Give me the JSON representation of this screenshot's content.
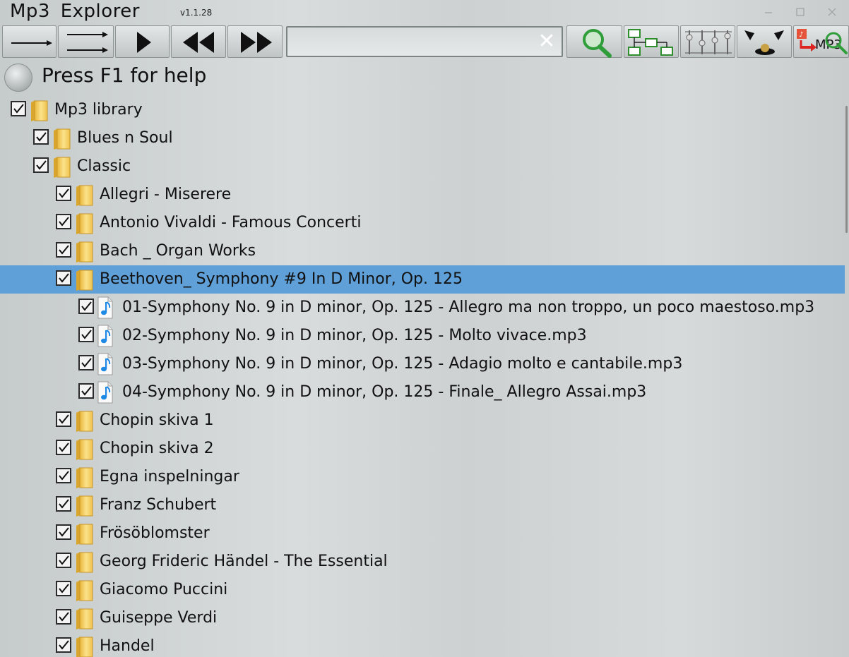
{
  "window": {
    "title": "Mp3  Explorer",
    "version": "v1.1.28"
  },
  "toolbar": {
    "search_value": "",
    "clear_glyph": "✕"
  },
  "status": {
    "text": "Press F1 for help"
  },
  "tree": {
    "rows": [
      {
        "label": "Mp3 library",
        "type": "folder",
        "level": 0,
        "checked": true,
        "selected": false
      },
      {
        "label": "Blues n Soul",
        "type": "folder",
        "level": 1,
        "checked": true,
        "selected": false
      },
      {
        "label": "Classic",
        "type": "folder",
        "level": 1,
        "checked": true,
        "selected": false
      },
      {
        "label": "Allegri - Miserere",
        "type": "folder",
        "level": 2,
        "checked": true,
        "selected": false
      },
      {
        "label": "Antonio Vivaldi - Famous Concerti",
        "type": "folder",
        "level": 2,
        "checked": true,
        "selected": false
      },
      {
        "label": "Bach _ Organ Works",
        "type": "folder",
        "level": 2,
        "checked": true,
        "selected": false
      },
      {
        "label": "Beethoven_ Symphony #9 In D Minor, Op. 125",
        "type": "folder",
        "level": 2,
        "checked": true,
        "selected": true
      },
      {
        "label": "01-Symphony No. 9 in D minor, Op. 125 - Allegro ma non troppo, un poco maestoso.mp3",
        "type": "file",
        "level": 3,
        "checked": true,
        "selected": false
      },
      {
        "label": "02-Symphony No. 9 in D minor, Op. 125 - Molto vivace.mp3",
        "type": "file",
        "level": 3,
        "checked": true,
        "selected": false
      },
      {
        "label": "03-Symphony No. 9 in D minor, Op. 125 - Adagio molto e cantabile.mp3",
        "type": "file",
        "level": 3,
        "checked": true,
        "selected": false
      },
      {
        "label": "04-Symphony No. 9 in D minor, Op. 125 - Finale_ Allegro Assai.mp3",
        "type": "file",
        "level": 3,
        "checked": true,
        "selected": false
      },
      {
        "label": "Chopin skiva 1",
        "type": "folder",
        "level": 2,
        "checked": true,
        "selected": false
      },
      {
        "label": "Chopin skiva 2",
        "type": "folder",
        "level": 2,
        "checked": true,
        "selected": false
      },
      {
        "label": "Egna inspelningar",
        "type": "folder",
        "level": 2,
        "checked": true,
        "selected": false
      },
      {
        "label": "Franz Schubert",
        "type": "folder",
        "level": 2,
        "checked": true,
        "selected": false
      },
      {
        "label": "Frösöblomster",
        "type": "folder",
        "level": 2,
        "checked": true,
        "selected": false
      },
      {
        "label": "Georg Frideric Händel - The Essential",
        "type": "folder",
        "level": 2,
        "checked": true,
        "selected": false
      },
      {
        "label": "Giacomo Puccini",
        "type": "folder",
        "level": 2,
        "checked": true,
        "selected": false
      },
      {
        "label": "Guiseppe Verdi",
        "type": "folder",
        "level": 2,
        "checked": true,
        "selected": false
      },
      {
        "label": "Handel",
        "type": "folder",
        "level": 2,
        "checked": true,
        "selected": false
      }
    ]
  },
  "colors": {
    "selection": "#5fa0d8",
    "folder": "#f2c94c",
    "note": "#1e88e5"
  }
}
